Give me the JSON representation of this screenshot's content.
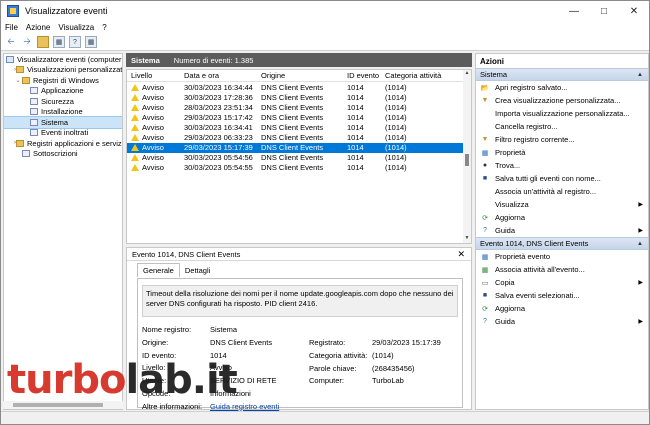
{
  "window": {
    "title": "Visualizzatore eventi"
  },
  "menu": [
    "File",
    "Azione",
    "Visualizza",
    "?"
  ],
  "tree": {
    "items": [
      {
        "label": "Visualizzatore eventi (computer l",
        "level": 0,
        "icon": "event-viewer-icon",
        "expand": ""
      },
      {
        "label": "Visualizzazioni personalizzate",
        "level": 1,
        "icon": "folder-icon",
        "expand": "›"
      },
      {
        "label": "Registri di Windows",
        "level": 1,
        "icon": "folder-icon",
        "expand": "⌄"
      },
      {
        "label": "Applicazione",
        "level": 2,
        "icon": "log-icon",
        "expand": ""
      },
      {
        "label": "Sicurezza",
        "level": 2,
        "icon": "log-icon",
        "expand": ""
      },
      {
        "label": "Installazione",
        "level": 2,
        "icon": "log-icon",
        "expand": ""
      },
      {
        "label": "Sistema",
        "level": 2,
        "icon": "log-icon",
        "expand": "",
        "selected": true
      },
      {
        "label": "Eventi inoltrati",
        "level": 2,
        "icon": "log-icon",
        "expand": ""
      },
      {
        "label": "Registri applicazioni e servizi",
        "level": 1,
        "icon": "folder-icon",
        "expand": "›"
      },
      {
        "label": "Sottoscrizioni",
        "level": 1,
        "icon": "log-icon",
        "expand": ""
      }
    ]
  },
  "header": {
    "log_name": "Sistema",
    "count_label": "Numero di eventi: 1.385"
  },
  "grid": {
    "columns": [
      "Livello",
      "Data e ora",
      "Origine",
      "ID evento",
      "Categoria attività"
    ],
    "rows": [
      [
        "Avviso",
        "30/03/2023 16:34:44",
        "DNS Client Events",
        "1014",
        "(1014)"
      ],
      [
        "Avviso",
        "30/03/2023 17:28:36",
        "DNS Client Events",
        "1014",
        "(1014)"
      ],
      [
        "Avviso",
        "28/03/2023 23:51:34",
        "DNS Client Events",
        "1014",
        "(1014)"
      ],
      [
        "Avviso",
        "29/03/2023 15:17:42",
        "DNS Client Events",
        "1014",
        "(1014)"
      ],
      [
        "Avviso",
        "30/03/2023 16:34:41",
        "DNS Client Events",
        "1014",
        "(1014)"
      ],
      [
        "Avviso",
        "29/03/2023 06:33:23",
        "DNS Client Events",
        "1014",
        "(1014)"
      ],
      [
        "Avviso",
        "29/03/2023 15:17:39",
        "DNS Client Events",
        "1014",
        "(1014)"
      ],
      [
        "Avviso",
        "30/03/2023 05:54:56",
        "DNS Client Events",
        "1014",
        "(1014)"
      ],
      [
        "Avviso",
        "30/03/2023 05:54:55",
        "DNS Client Events",
        "1014",
        "(1014)"
      ]
    ],
    "selected_index": 6
  },
  "detail": {
    "title": "Evento 1014, DNS Client Events",
    "tabs": [
      "Generale",
      "Dettagli"
    ],
    "message": "Timeout della risoluzione dei nomi per il nome update.googleapis.com dopo che nessuno dei server DNS configurati ha risposto. PID client 2416.",
    "fields_left": [
      {
        "k": "Nome registro:",
        "v": "Sistema"
      },
      {
        "k": "Origine:",
        "v": "DNS Client Events"
      },
      {
        "k": "ID evento:",
        "v": "1014"
      },
      {
        "k": "Livello:",
        "v": "Avviso"
      },
      {
        "k": "Utente:",
        "v": "SERVIZIO DI RETE"
      },
      {
        "k": "Opcode:",
        "v": "Informazioni"
      },
      {
        "k": "Altre informazioni:",
        "v": "Guida registro eventi"
      }
    ],
    "fields_right": [
      {
        "k": "Registrato:",
        "v": "29/03/2023 15:17:39"
      },
      {
        "k": "Categoria attività:",
        "v": "(1014)"
      },
      {
        "k": "Parole chiave:",
        "v": "(268435456)"
      },
      {
        "k": "Computer:",
        "v": "TurboLab"
      }
    ]
  },
  "actions": {
    "title": "Azioni",
    "section1": "Sistema",
    "items1": [
      {
        "label": "Apri registro salvato...",
        "icon": "folder-open-icon",
        "arrow": false
      },
      {
        "label": "Crea visualizzazione personalizzata...",
        "icon": "filter-icon",
        "arrow": false
      },
      {
        "label": "Importa visualizzazione personalizzata...",
        "icon": "",
        "arrow": false
      },
      {
        "label": "Cancella registro...",
        "icon": "",
        "arrow": false
      },
      {
        "label": "Filtro registro corrente...",
        "icon": "filter-icon",
        "arrow": false
      },
      {
        "label": "Proprietà",
        "icon": "properties-icon",
        "arrow": false
      },
      {
        "label": "Trova...",
        "icon": "find-icon",
        "arrow": false
      },
      {
        "label": "Salva tutti gli eventi con nome...",
        "icon": "save-icon",
        "arrow": false
      },
      {
        "label": "Associa un'attività al registro...",
        "icon": "",
        "arrow": false
      },
      {
        "label": "Visualizza",
        "icon": "",
        "arrow": true
      },
      {
        "label": "Aggiorna",
        "icon": "refresh-icon",
        "arrow": false
      },
      {
        "label": "Guida",
        "icon": "help-icon",
        "arrow": true
      }
    ],
    "section2": "Evento 1014, DNS Client Events",
    "items2": [
      {
        "label": "Proprietà evento",
        "icon": "properties-icon",
        "arrow": false
      },
      {
        "label": "Associa attività all'evento...",
        "icon": "task-icon",
        "arrow": false
      },
      {
        "label": "Copia",
        "icon": "copy-icon",
        "arrow": true
      },
      {
        "label": "Salva eventi selezionati...",
        "icon": "save-icon",
        "arrow": false
      },
      {
        "label": "Aggiorna",
        "icon": "refresh-icon",
        "arrow": false
      },
      {
        "label": "Guida",
        "icon": "help-icon",
        "arrow": true
      }
    ]
  },
  "watermark": {
    "part1": "turbo",
    "part2": "lab.it"
  },
  "colors": {
    "selection": "#0078d7",
    "header": "#5c5c5c",
    "accent_red": "#d42a1e"
  }
}
